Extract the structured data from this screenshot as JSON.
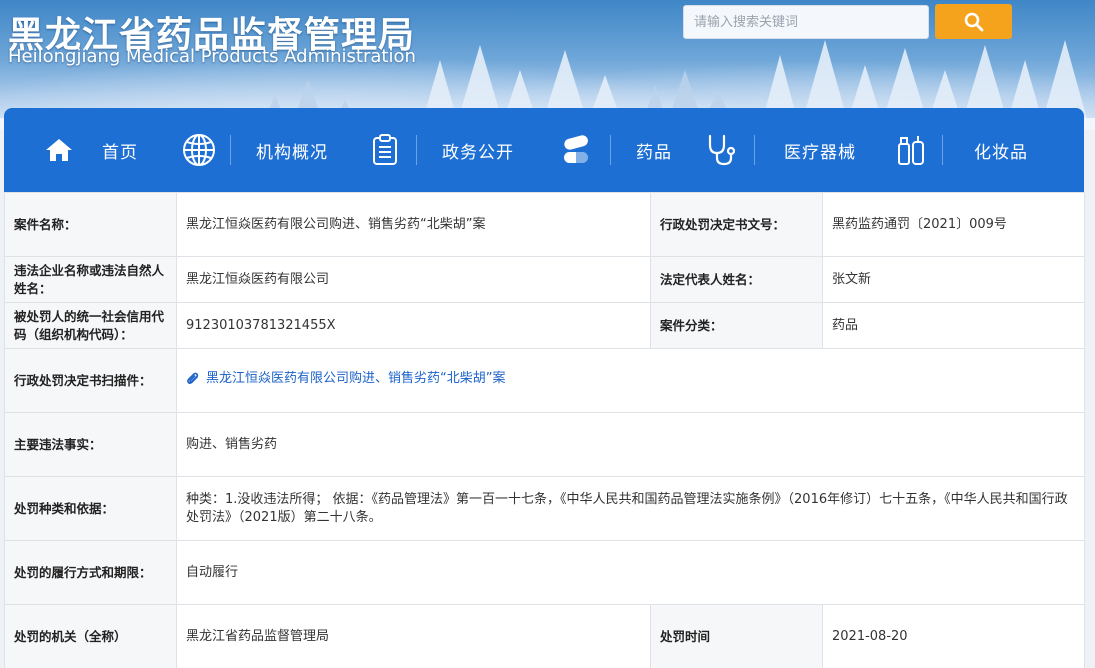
{
  "header": {
    "title": "黑龙江省药品监督管理局",
    "subtitle": "Heilongjiang Medical Products Administration",
    "search": {
      "placeholder": "请输入搜索关键词",
      "button_icon": "search-icon"
    }
  },
  "nav": {
    "items": [
      {
        "label": "首页",
        "icon": "home-icon"
      },
      {
        "label": "机构概况",
        "icon": "globe-icon"
      },
      {
        "label": "政务公开",
        "icon": "clipboard-icon"
      },
      {
        "label": "药品",
        "icon": "pill-capsule-icon"
      },
      {
        "label": "医疗器械",
        "icon": "stethoscope-icon"
      },
      {
        "label": "化妆品",
        "icon": "cosmetics-bottle-icon"
      }
    ]
  },
  "case": {
    "name_label": "案件名称：",
    "name_value": "黑龙江恒焱医药有限公司购进、销售劣药“北柴胡”案",
    "doc_no_label": "行政处罚决定书文号：",
    "doc_no_value": "黑药监药通罚〔2021〕009号",
    "party_label": "违法企业名称或违法自然人姓名：",
    "party_value": "黑龙江恒焱医药有限公司",
    "legal_rep_label": "法定代表人姓名：",
    "legal_rep_value": "张文新",
    "credit_code_label": "被处罚人的统一社会信用代码（组织机构代码）：",
    "credit_code_value": "91230103781321455X",
    "category_label": "案件分类：",
    "category_value": "药品",
    "scan_label": "行政处罚决定书扫描件：",
    "scan_link": "黑龙江恒焱医药有限公司购进、销售劣药“北柴胡”案",
    "facts_label": "主要违法事实：",
    "facts_value": "购进、销售劣药",
    "basis_label": "处罚种类和依据：",
    "basis_value": "种类：1.没收违法所得； 依据：《药品管理法》第一百一十七条，《中华人民共和国药品管理法实施条例》（2016年修订）七十五条，《中华人民共和国行政处罚法》（2021版）第二十八条。",
    "performance_label": "处罚的履行方式和期限：",
    "performance_value": "自动履行",
    "authority_label": "处罚的机关（全称）",
    "authority_value": "黑龙江省药品监督管理局",
    "date_label": "处罚时间",
    "date_value": "2021-08-20"
  },
  "colors": {
    "nav_bg": "#1e6fd3",
    "search_button": "#f5a31c",
    "link": "#1c62c9"
  }
}
